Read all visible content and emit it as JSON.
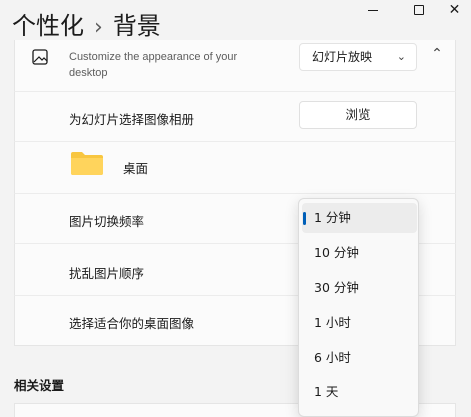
{
  "header": {
    "title_parent": "个性化",
    "separator": "›",
    "title_current": "背景"
  },
  "window_controls": {
    "close_glyph": "✕"
  },
  "background_row": {
    "icon": "picture-icon",
    "description": "Customize the appearance of your desktop",
    "select_value": "幻灯片放映",
    "select_chevron": "⌄",
    "collapse_glyph": "⌃"
  },
  "album_row": {
    "label": "为幻灯片选择图像相册",
    "browse_label": "浏览"
  },
  "folder_row": {
    "icon": "folder-icon",
    "label": "桌面"
  },
  "settings": {
    "interval_label": "图片切换频率",
    "shuffle_label": "扰乱图片顺序",
    "fit_label": "选择适合你的桌面图像"
  },
  "related": {
    "title": "相关设置"
  },
  "dropdown": {
    "options": [
      "1 分钟",
      "10 分钟",
      "30 分钟",
      "1 小时",
      "6 小时",
      "1 天"
    ],
    "selected_index": 0
  },
  "colors": {
    "accent": "#005fb8",
    "folder": "#f8c640"
  }
}
